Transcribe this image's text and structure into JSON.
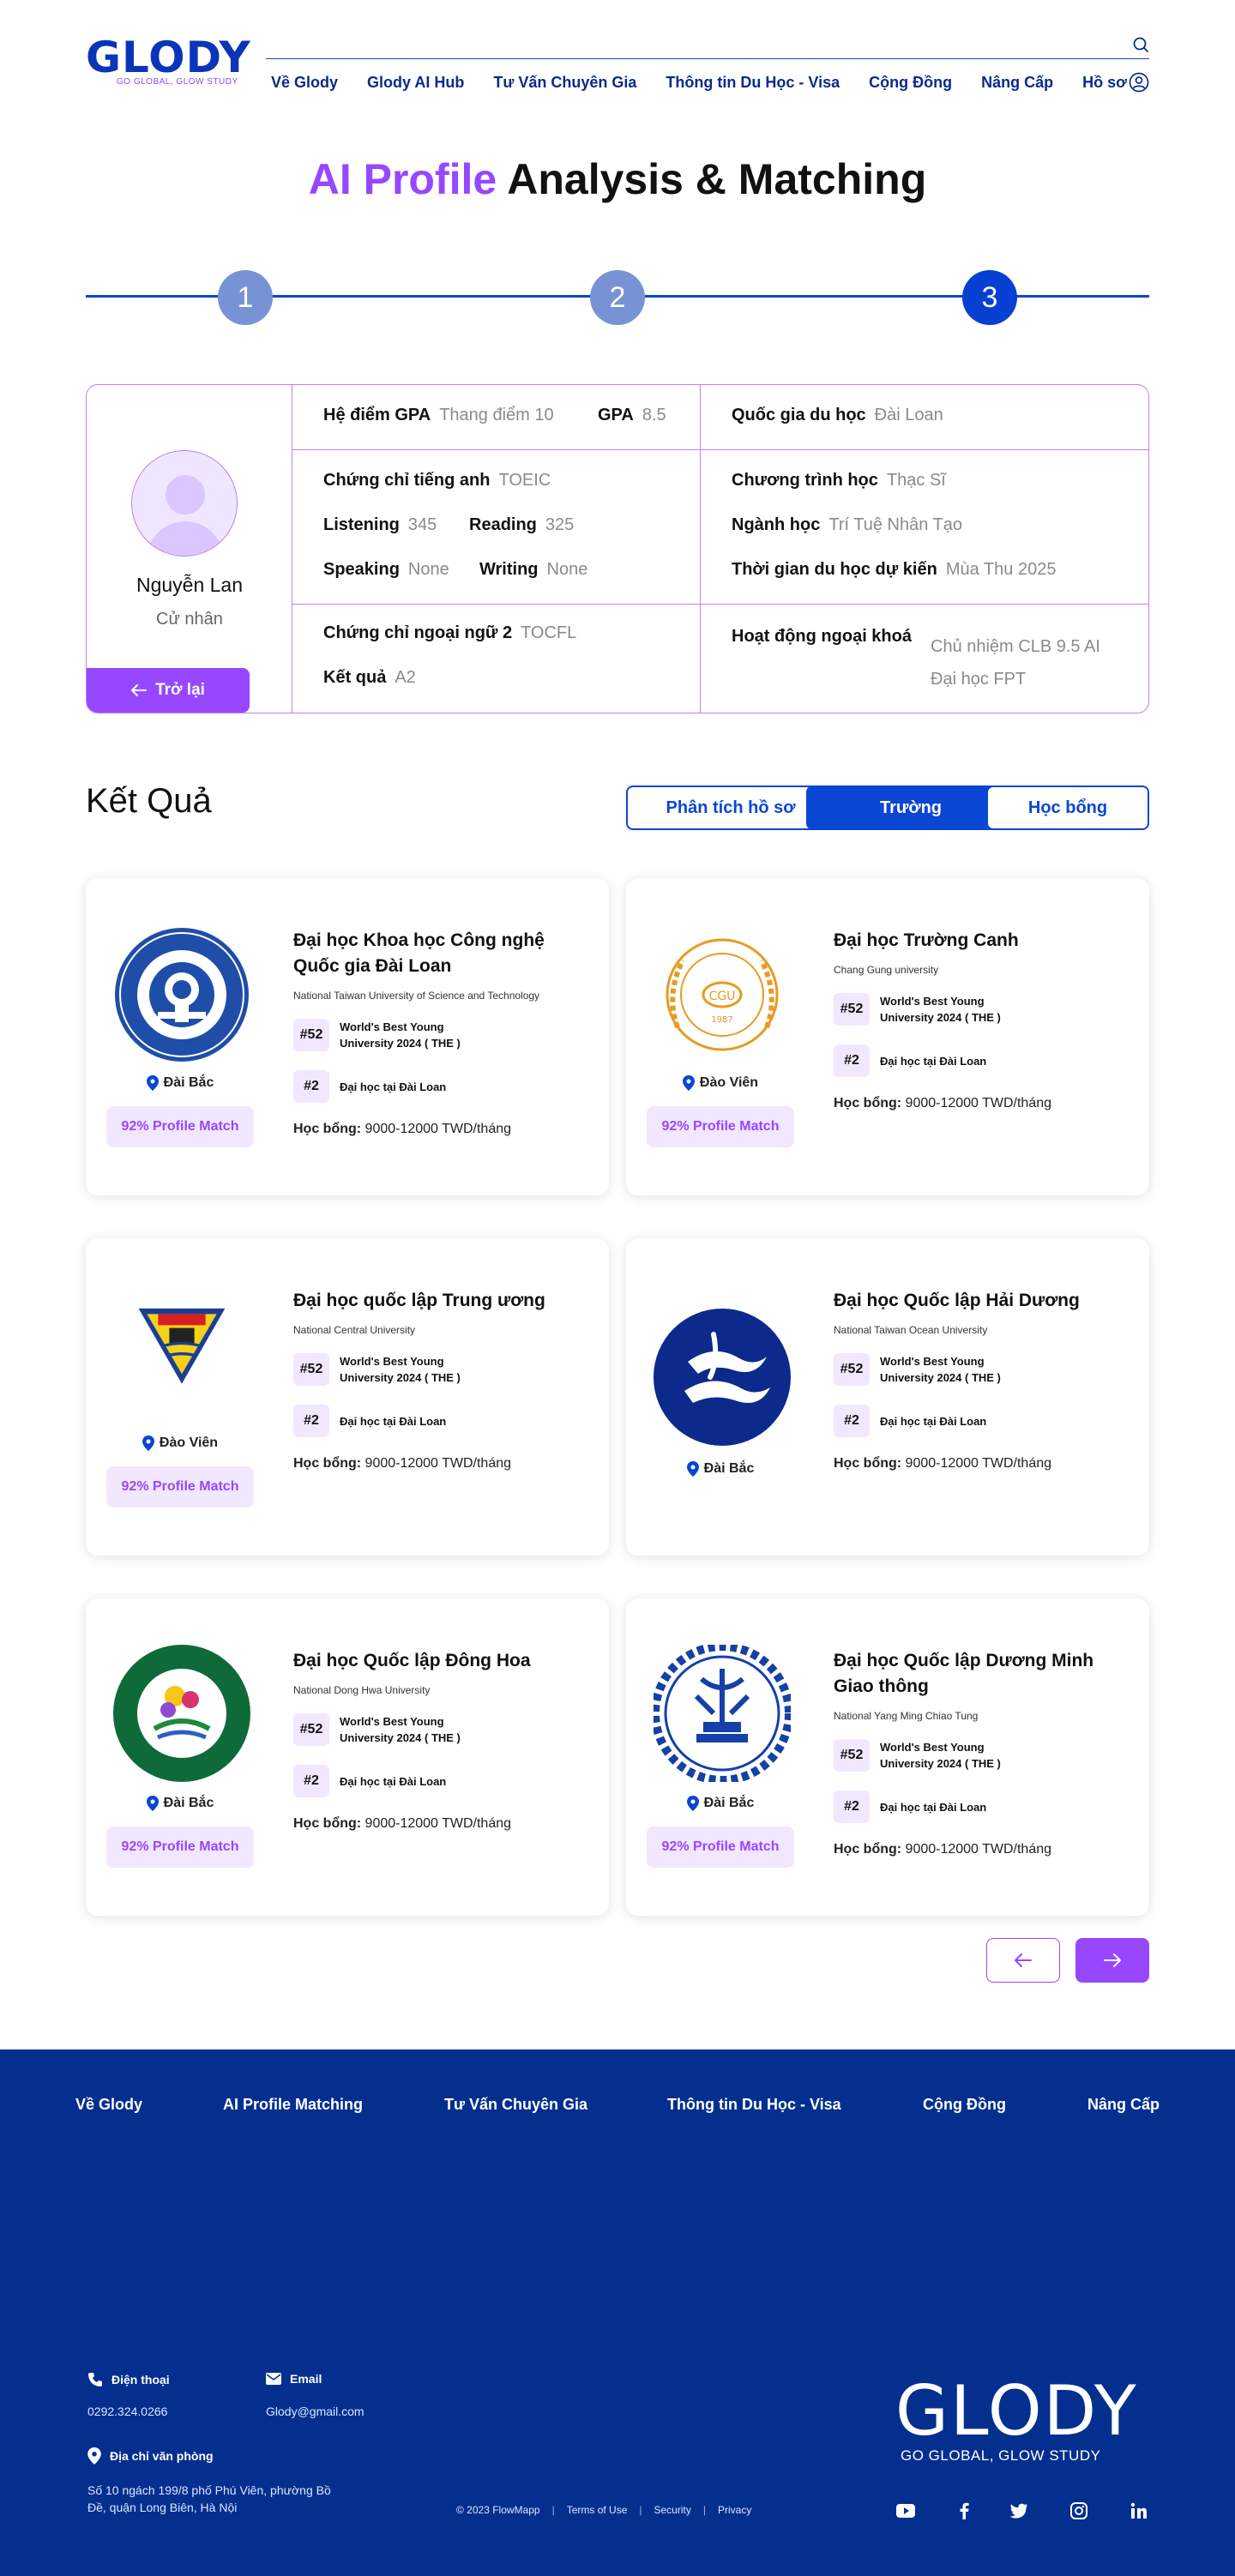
{
  "brand": {
    "logo_text": "GLODY",
    "tagline": "GO GLOBAL, GLOW STUDY",
    "primary": "#0a46d4",
    "accent": "#9747ff",
    "footer_bg": "#042f8f"
  },
  "nav": {
    "items": [
      "Về Glody",
      "Glody AI Hub",
      "Tư Vấn Chuyên Gia",
      "Thông tin Du Học - Visa",
      "Cộng Đồng",
      "Nâng Cấp",
      "Hồ sơ"
    ]
  },
  "title": {
    "accent": "AI Profile",
    "rest": " Analysis & Matching"
  },
  "stepper": {
    "steps": [
      "1",
      "2",
      "3"
    ],
    "active": 3
  },
  "profile": {
    "name": "Nguyễn Lan",
    "degree": "Cử nhân",
    "back_label": "Trở lại",
    "gpa_scale_label": "Hệ điểm GPA",
    "gpa_scale_value": "Thang điểm 10",
    "gpa_label": "GPA",
    "gpa_value": "8.5",
    "country_label": "Quốc gia du học",
    "country_value": "Đài Loan",
    "eng_cert_label": "Chứng chỉ tiếng anh",
    "eng_cert_value": "TOEIC",
    "listening_label": "Listening",
    "listening_value": "345",
    "reading_label": "Reading",
    "reading_value": "325",
    "speaking_label": "Speaking",
    "speaking_value": "None",
    "writing_label": "Writing",
    "writing_value": "None",
    "program_label": "Chương trình học",
    "program_value": "Thạc Sĩ",
    "major_label": "Ngành học",
    "major_value": "Trí Tuệ Nhân Tạo",
    "time_label": "Thời gian du học dự kiến",
    "time_value": "Mùa Thu 2025",
    "lang2_label": "Chứng chỉ ngoại ngữ 2",
    "lang2_value": "TOCFL",
    "result_label": "Kết quả",
    "result_value": "A2",
    "extra_label": "Hoạt động ngoại khoá",
    "extra_value_1": "Chủ nhiệm CLB 9.5 AI",
    "extra_value_2": "Đại học FPT"
  },
  "results": {
    "title": "Kết Quả",
    "tabs": [
      "Phân tích hồ sơ",
      "Trường",
      "Học bổng"
    ],
    "active_tab": 1
  },
  "common": {
    "rank1_badge": "#52",
    "rank1_text_1": "World's Best Young",
    "rank1_text_2": "University 2024 ( THE )",
    "rank2_badge": "#2",
    "rank2_text": "Đại học tại Đài Loan",
    "scholarship_label": "Học bổng:",
    "scholarship_value": " 9000-12000 TWD/tháng",
    "match": "92% Profile Match"
  },
  "universities": [
    {
      "name_1": "Đại học Khoa học Công nghệ",
      "name_2": "Quốc gia Đài Loan",
      "en": "National Taiwan University of Science and Technology",
      "location": "Đài Bắc",
      "logo": "ntust-seal-icon"
    },
    {
      "name_1": "Đại học Trường Canh",
      "name_2": "",
      "en": "Chang Gung university",
      "location": "Đào Viên",
      "logo": "chang-gung-seal-icon"
    },
    {
      "name_1": "Đại học quốc lập Trung ương",
      "name_2": "",
      "en": "National Central University",
      "location": "Đào Viên",
      "logo": "ncu-triangle-icon"
    },
    {
      "name_1": "Đại học Quốc lập Hải Dương",
      "name_2": "",
      "en": "National Taiwan Ocean University",
      "location": "Đài Bắc",
      "logo": "ntou-wave-icon"
    },
    {
      "name_1": "Đại học Quốc lập Đông Hoa",
      "name_2": "",
      "en": "National Dong Hwa University",
      "location": "Đài Bắc",
      "logo": "ndhu-seal-icon"
    },
    {
      "name_1": "Đại học Quốc lập Dương Minh",
      "name_2": "Giao thông",
      "en": "National Yang Ming Chiao Tung",
      "location": "Đài Bắc",
      "logo": "nycu-gear-icon"
    }
  ],
  "footer": {
    "nav": [
      "Về Glody",
      "AI Profile Matching",
      "Tư Vấn Chuyên Gia",
      "Thông tin Du Học - Visa",
      "Cộng Đồng",
      "Nâng Cấp"
    ],
    "phone_label": "Điện thoại",
    "phone_value": "0292.324.0266",
    "email_label": "Email",
    "email_value": "Glody@gmail.com",
    "address_label": "Địa chỉ văn phòng",
    "address_1": "Số 10 ngách 199/8 phố Phú Viên, phường Bồ",
    "address_2": "Đề, quận Long Biên, Hà Nội",
    "copyright": "© 2023 FlowMapp",
    "terms": "Terms of Use",
    "security": "Security",
    "privacy": "Privacy",
    "social": [
      "youtube-icon",
      "facebook-icon",
      "twitter-icon",
      "instagram-icon",
      "linkedin-icon"
    ]
  }
}
